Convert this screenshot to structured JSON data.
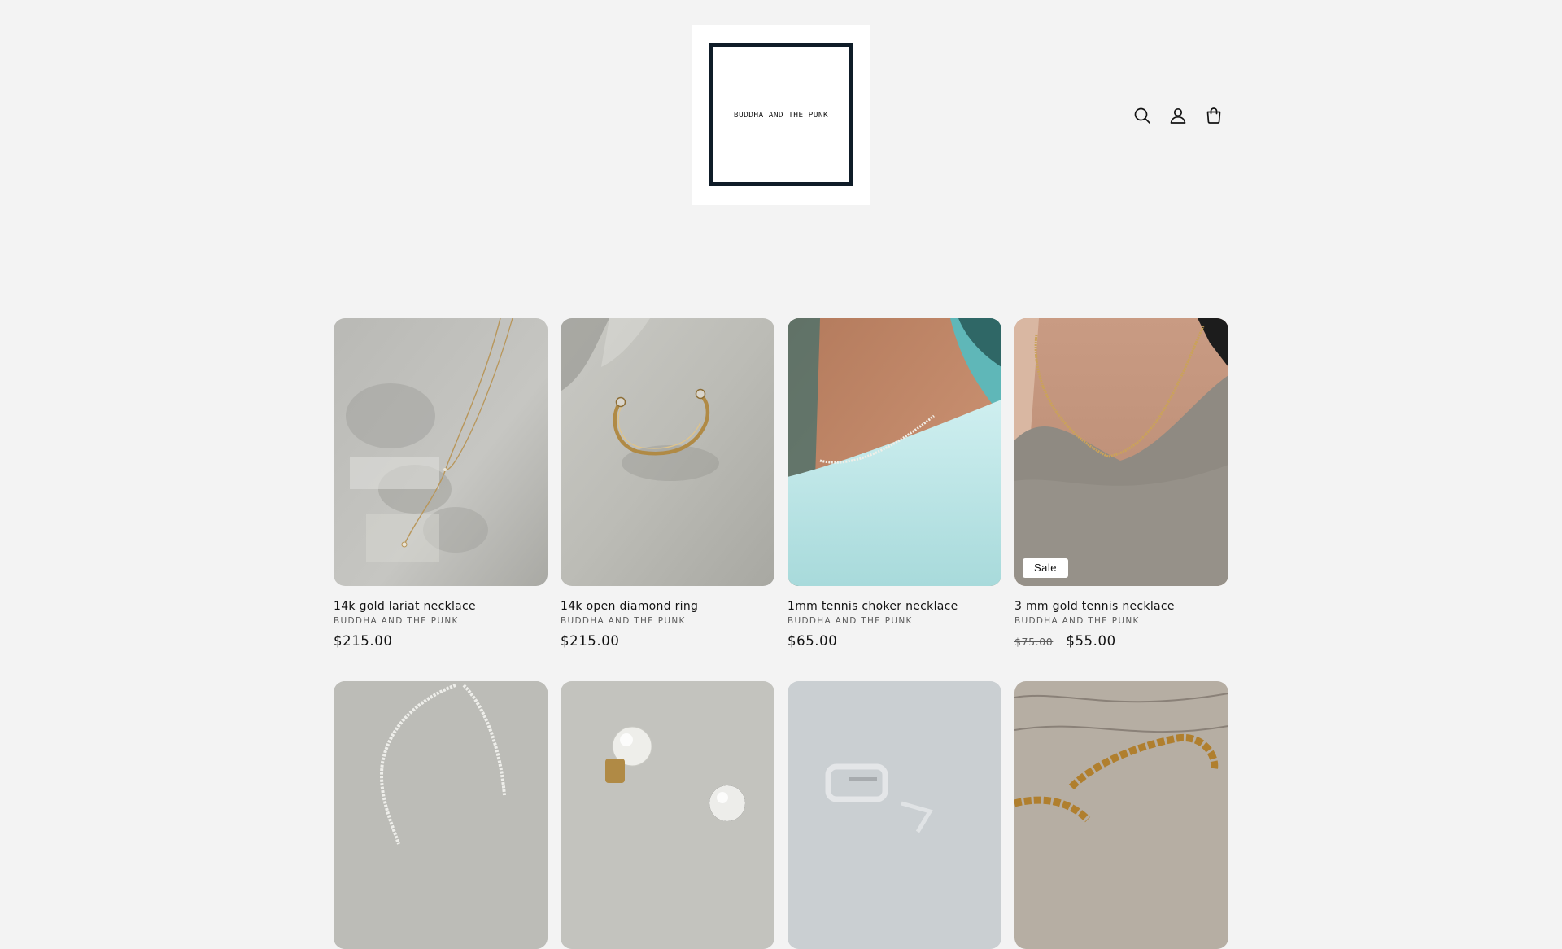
{
  "header": {
    "logo_text": "BUDDHA AND THE PUNK",
    "icons": [
      "search-icon",
      "account-icon",
      "cart-icon"
    ]
  },
  "products": [
    {
      "title": "14k gold lariat necklace",
      "vendor": "BUDDHA AND THE PUNK",
      "price": "$215.00"
    },
    {
      "title": "14k open diamond ring",
      "vendor": "BUDDHA AND THE PUNK",
      "price": "$215.00"
    },
    {
      "title": "1mm tennis choker necklace",
      "vendor": "BUDDHA AND THE PUNK",
      "price": "$65.00"
    },
    {
      "title": "3 mm gold tennis necklace",
      "vendor": "BUDDHA AND THE PUNK",
      "badge": "Sale",
      "price_regular": "$75.00",
      "price": "$55.00"
    }
  ],
  "colors": {
    "background": "#f3f3f3",
    "logo_frame": "#0f1c28",
    "text": "#121212",
    "muted_text": "#5c5c5c"
  }
}
